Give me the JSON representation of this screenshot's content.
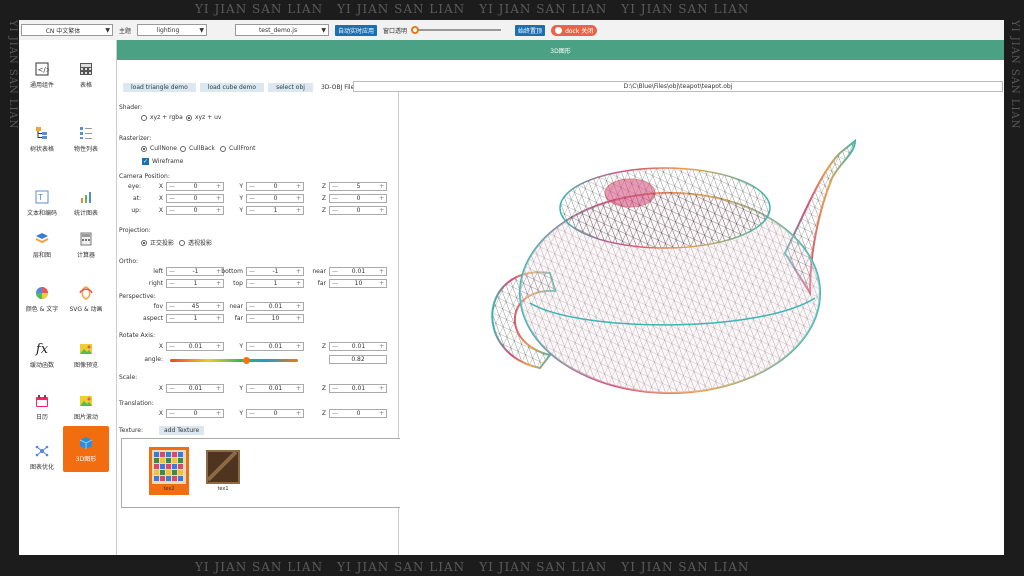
{
  "watermark": {
    "text": "YI JIAN SAN LIAN"
  },
  "toolbar": {
    "language": "CN 中文繁体",
    "theme_label": "主题",
    "theme_value": "lighting",
    "demo_file": "test_demo.js",
    "auto_apply": "自动实时应用",
    "opacity_label": "窗口透明",
    "always_top": "始终置顶",
    "dock_toggle": "dock 关闭"
  },
  "sidebar": {
    "items": [
      {
        "label": "通用组件",
        "icon": "code-file-icon"
      },
      {
        "label": "表格",
        "icon": "calculator-icon"
      },
      {
        "label": "树状表格",
        "icon": "tree-icon"
      },
      {
        "label": "物性列表",
        "icon": "list-icon"
      },
      {
        "label": "文本和编码",
        "icon": "text-edit-icon"
      },
      {
        "label": "统计图表",
        "icon": "chart-icon"
      },
      {
        "label": "层和图",
        "icon": "layers-icon"
      },
      {
        "label": "计算器",
        "icon": "keypad-icon"
      },
      {
        "label": "颜色 & 文字",
        "icon": "color-wheel-icon"
      },
      {
        "label": "SVG & 动画",
        "icon": "animation-icon"
      },
      {
        "label": "缓动函数",
        "icon": "function-icon"
      },
      {
        "label": "图像预览",
        "icon": "image-icon"
      },
      {
        "label": "日历",
        "icon": "calendar-icon"
      },
      {
        "label": "图片滚动",
        "icon": "image-scroll-icon"
      },
      {
        "label": "图表优化",
        "icon": "graph-nodes-icon"
      },
      {
        "label": "3D图形",
        "icon": "cube-icon"
      }
    ]
  },
  "main": {
    "title": "3D图形",
    "tabs": [
      "load triangle demo",
      "load cube demo",
      "select obj",
      "3D-OBJ File"
    ],
    "path": "D:\\C\\Blue\\Files\\obj\\teapot\\teapot.obj"
  },
  "panel": {
    "shader_label": "Shader:",
    "shader_options": [
      "xyz + rgba",
      "xyz + uv"
    ],
    "shader_selected": 1,
    "rasterizer_label": "Rasterizer:",
    "rasterizer_options": [
      "CullNone",
      "CullBack",
      "CullFront"
    ],
    "rasterizer_selected": 0,
    "wireframe_label": "Wireframe",
    "wireframe_checked": true,
    "camera_label": "Camera Position:",
    "camera_rows": [
      {
        "name": "eye:",
        "x": "0",
        "y": "0",
        "z": "5"
      },
      {
        "name": "at:",
        "x": "0",
        "y": "0",
        "z": "0"
      },
      {
        "name": "up:",
        "x": "0",
        "y": "1",
        "z": "0"
      }
    ],
    "axis_labels": {
      "x": "X",
      "y": "Y",
      "z": "Z"
    },
    "projection_label": "Projection:",
    "projection_options": [
      "正交投影",
      "透视投影"
    ],
    "projection_selected": 0,
    "ortho_label": "Ortho:",
    "ortho": {
      "left_label": "left",
      "left": "-1",
      "bottom_label": "bottom",
      "bottom": "-1",
      "near_label": "near",
      "near": "0.01",
      "right_label": "right",
      "right": "1",
      "top_label": "top",
      "top": "1",
      "far_label": "far",
      "far": "10"
    },
    "perspective_label": "Perspective:",
    "perspective": {
      "fov_label": "fov",
      "fov": "45",
      "near_label": "near",
      "near": "0.01",
      "aspect_label": "aspect",
      "aspect": "1",
      "far_label": "far",
      "far": "10"
    },
    "rotate_label": "Rotate Axis:",
    "rotate": {
      "x": "0.01",
      "y": "0.01",
      "z": "0.01"
    },
    "angle_label": "angle:",
    "angle_value": "0.82",
    "angle_fraction": 0.6,
    "scale_label": "Scale:",
    "scale": {
      "x": "0.01",
      "y": "0.01",
      "z": "0.01"
    },
    "translation_label": "Translation:",
    "translation": {
      "x": "0",
      "y": "0",
      "z": "0"
    },
    "texture_label": "Texture:",
    "add_texture": "add Texture",
    "textures": [
      {
        "name": "tex2",
        "selected": true,
        "icon": "tile-texture-icon"
      },
      {
        "name": "tex1",
        "selected": false,
        "icon": "wood-crate-icon"
      }
    ]
  }
}
